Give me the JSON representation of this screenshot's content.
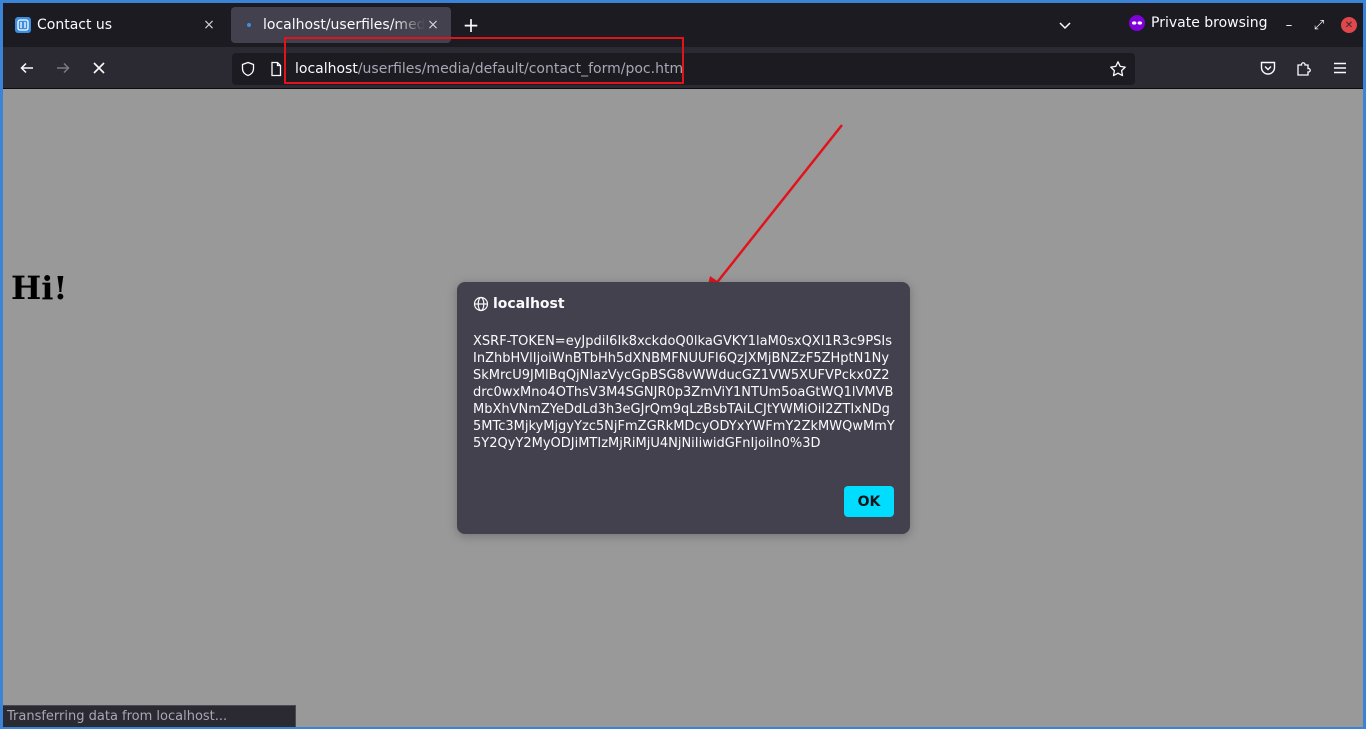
{
  "tabs": [
    {
      "title": "Contact us",
      "close": "×",
      "favicon": "joomla-icon"
    },
    {
      "title": "localhost/userfiles/media",
      "close": "×",
      "favicon": "loading-dot-icon"
    }
  ],
  "tabstrip": {
    "new_tab": "+",
    "private_label": "Private browsing",
    "minimize": "–",
    "maximize": "⤢",
    "close": "✕"
  },
  "urlbar": {
    "host": "localhost",
    "path": "/userfiles/media/default/contact_form/poc.htm"
  },
  "page": {
    "heading": "Hi!"
  },
  "dialog": {
    "origin": "localhost",
    "message": "XSRF-TOKEN=eyJpdiI6Ik8xckdoQ0lkaGVKY1laM0sxQXl1R3c9PSIsInZhbHVlIjoiWnBTbHh5dXNBMFNUUFl6QzJXMjBNZzF5ZHptN1NySkMrcU9JMlBqQjNlazVycGpBSG8vWWducGZ1VW5XUFVPckx0Z2drc0wxMno4OThsV3M4SGNJR0p3ZmViY1NTUm5oaGtWQ1lVMVBMbXhVNmZYeDdLd3h3eGJrQm9qLzBsbTAiLCJtYWMiOiI2ZTIxNDg5MTc3MjkyMjgyYzc5NjFmZGRkMDcyODYxYWFmY2ZkMWQwMmY5Y2QyY2MyODJiMTIzMjRiMjU4NjNiIiwidGFnIjoiIn0%3D",
    "ok_label": "OK"
  },
  "status": {
    "text": "Transferring data from localhost..."
  },
  "colors": {
    "annotation": "#e1141c",
    "accent": "#00ddff",
    "page_background": "#999999"
  }
}
